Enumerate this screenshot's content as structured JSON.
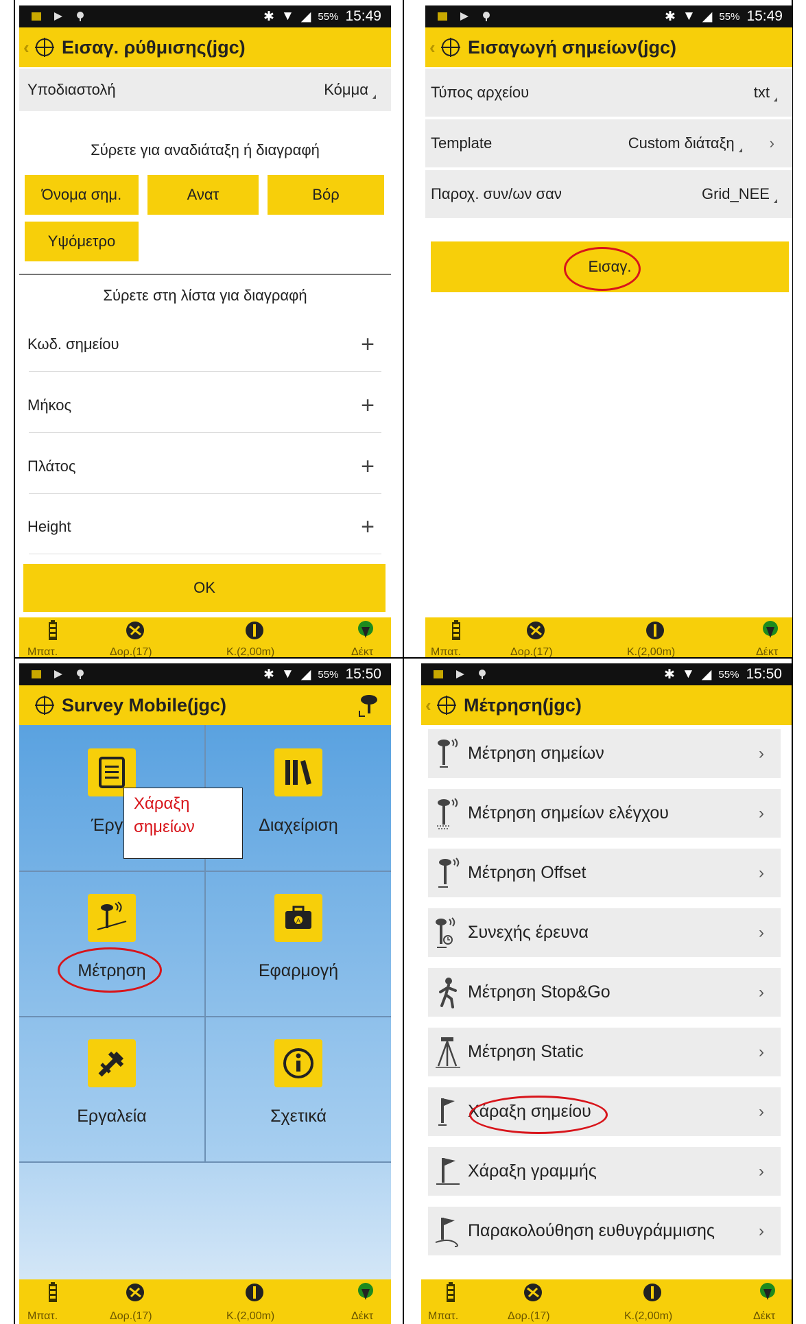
{
  "status": {
    "battery": "55%",
    "time_p1": "15:49",
    "time_p2": "15:49",
    "time_p3": "15:50",
    "time_p4": "15:50"
  },
  "bottombar": {
    "battery": "Μπατ.",
    "satellites": "Δορ.(17)",
    "station": "Κ.(2,00m)",
    "receiver": "Δέκτ"
  },
  "panel1": {
    "title": "Εισαγ. ρύθμισης(jgc)",
    "decimal_label": "Υποδιαστολή",
    "decimal_value": "Κόμμα",
    "drag_reorder": "Σύρετε για αναδιάταξη ή διαγραφή",
    "fields": [
      "Όνομα σημ.",
      "Ανατ",
      "Βόρ",
      "Υψόμετρο"
    ],
    "drag_delete": "Σύρετε στη λίστα για διαγραφή",
    "available": [
      "Κωδ. σημείου",
      "Μήκος",
      "Πλάτος",
      "Height"
    ],
    "ok": "OK"
  },
  "panel2": {
    "title": "Εισαγωγή σημείων(jgc)",
    "filetype_label": "Τύπος αρχείου",
    "filetype_value": "txt",
    "template_label": "Template",
    "template_value": "Custom διάταξη",
    "coords_label": "Παροχ. συν/ων σαν",
    "coords_value": "Grid_NEE",
    "import": "Εισαγ."
  },
  "panel3": {
    "title": "Survey Mobile(jgc)",
    "tiles": [
      "Έργο",
      "Διαχείριση",
      "Μέτρηση",
      "Εφαρμογή",
      "Εργαλεία",
      "Σχετικά"
    ],
    "callout": [
      "Χάραξη",
      "σημείων"
    ]
  },
  "panel4": {
    "title": "Μέτρηση(jgc)",
    "items": [
      "Μέτρηση σημείων",
      "Μέτρηση σημείων ελέγχου",
      "Μέτρηση Offset",
      "Συνεχής έρευνα",
      "Μέτρηση Stop&Go",
      "Μέτρηση Static",
      "Χάραξη σημείου",
      "Χάραξη γραμμής",
      "Παρακολούθηση ευθυγράμμισης"
    ]
  },
  "colors": {
    "accent_yellow": "#f7cf0a",
    "tile_blue": "#72b3e8",
    "annotation_red": "#d8151b"
  }
}
